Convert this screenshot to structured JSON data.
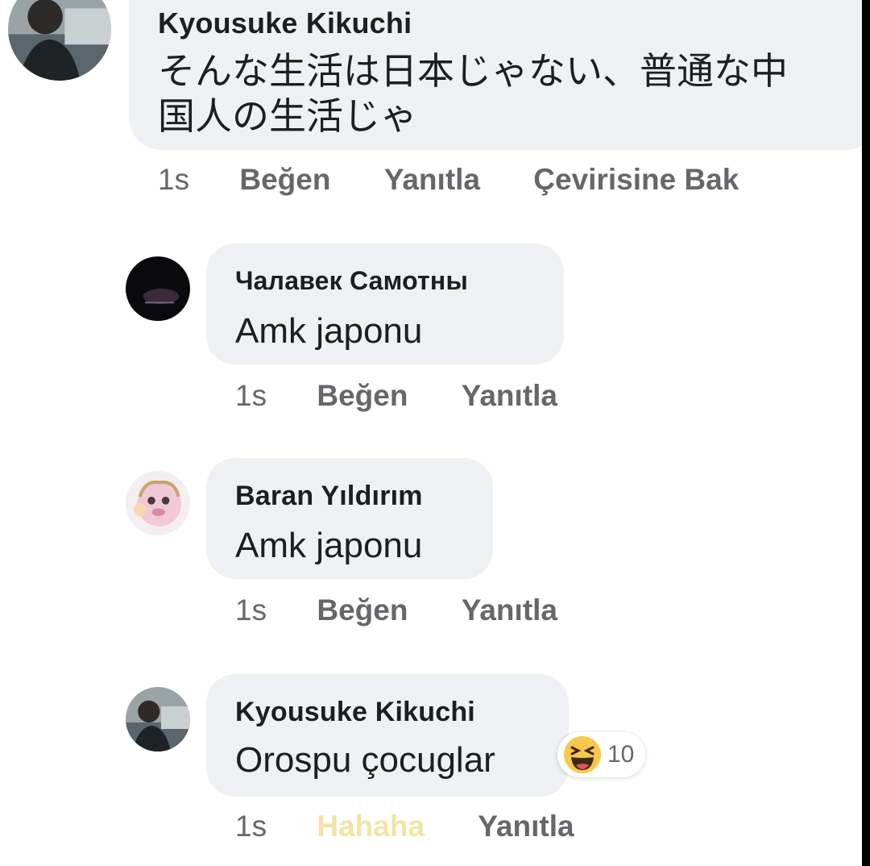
{
  "colors": {
    "bubble": "#eff0f4",
    "name_text": "#1c1e21",
    "meta_text": "#65676b",
    "haha_active": "#f0e5a4",
    "haha_emoji": "#f7c84b"
  },
  "comments": [
    {
      "author": "Kyousuke Kikuchi",
      "text_lines": [
        "そんな生活は日本じゃない、普通な中",
        "国人の生活じゃ"
      ],
      "time": "1s",
      "like": "Beğen",
      "reply": "Yanıtla",
      "translate": "Çevirisine Bak",
      "avatar_icon": "profile-photo"
    },
    {
      "author": "Чалавек Самотны",
      "text": "Amk  japonu",
      "time": "1s",
      "like": "Beğen",
      "reply": "Yanıtla",
      "avatar_icon": "profile-photo"
    },
    {
      "author": "Baran Yıldırım",
      "text": "Amk  japonu",
      "time": "1s",
      "like": "Beğen",
      "reply": "Yanıtla",
      "avatar_icon": "profile-photo"
    },
    {
      "author": "Kyousuke Kikuchi",
      "text": "Orospu çocuglar",
      "time": "1s",
      "like": "Hahaha",
      "reply": "Yanıtla",
      "avatar_icon": "profile-photo",
      "reaction": {
        "icon": "haha-emoji-icon",
        "count": "10"
      }
    }
  ]
}
